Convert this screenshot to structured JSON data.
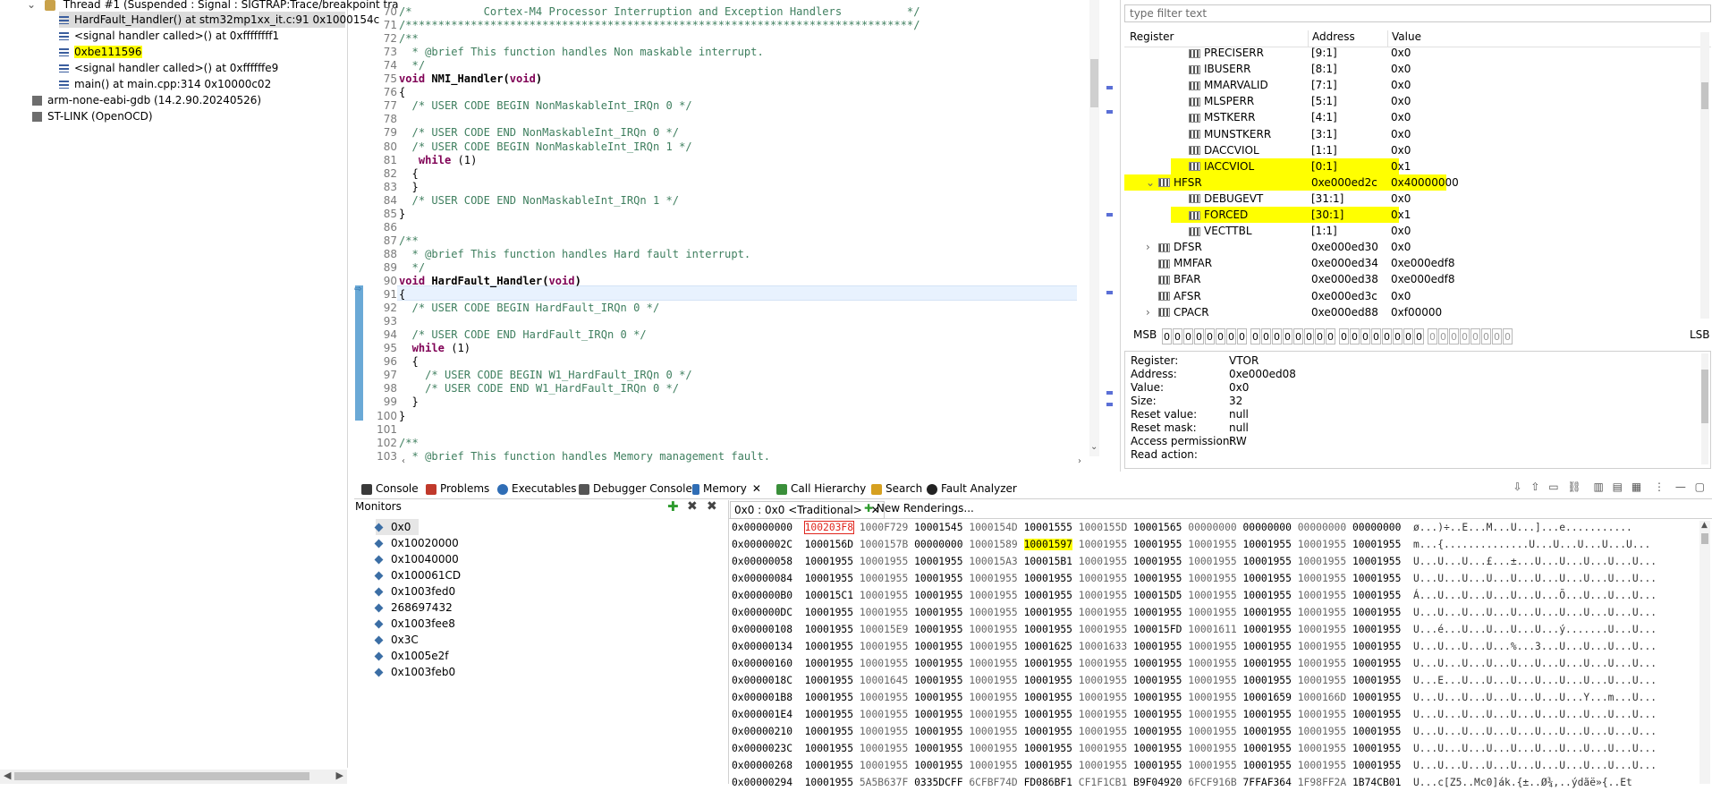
{
  "debug_tree": {
    "thread": "Thread #1 (Suspended : Signal : SIGTRAP:Trace/breakpoint tra",
    "frames": [
      "HardFault_Handler() at stm32mp1xx_it.c:91 0x1000154c",
      "<signal handler called>() at 0xffffffff1",
      "0xbe111596",
      "<signal handler called>() at 0xffffffe9",
      "main() at main.cpp:314 0x10000c02"
    ],
    "gdb": "arm-none-eabi-gdb (14.2.90.20240526)",
    "stlink": "ST-LINK (OpenOCD)"
  },
  "editor": {
    "lines": [
      {
        "n": "70",
        "t": "/*           Cortex-M4 Processor Interruption and Exception Handlers          */",
        "c": "cm"
      },
      {
        "n": "71",
        "t": "/******************************************************************************/",
        "c": "cm"
      },
      {
        "n": "72",
        "t": "/**",
        "c": "cm"
      },
      {
        "n": "73",
        "t": "  * @brief This function handles Non maskable interrupt.",
        "c": "cm"
      },
      {
        "n": "74",
        "t": "  */",
        "c": "cm"
      },
      {
        "n": "75",
        "t": "void NMI_Handler(void)",
        "c": "fnsig"
      },
      {
        "n": "76",
        "t": "{",
        "c": ""
      },
      {
        "n": "77",
        "t": "  /* USER CODE BEGIN NonMaskableInt_IRQn 0 */",
        "c": "cm"
      },
      {
        "n": "78",
        "t": "",
        "c": ""
      },
      {
        "n": "79",
        "t": "  /* USER CODE END NonMaskableInt_IRQn 0 */",
        "c": "cm"
      },
      {
        "n": "80",
        "t": "  /* USER CODE BEGIN NonMaskableInt_IRQn 1 */",
        "c": "cm"
      },
      {
        "n": "81",
        "t": "   while (1)",
        "c": "kw"
      },
      {
        "n": "82",
        "t": "  {",
        "c": ""
      },
      {
        "n": "83",
        "t": "  }",
        "c": ""
      },
      {
        "n": "84",
        "t": "  /* USER CODE END NonMaskableInt_IRQn 1 */",
        "c": "cm"
      },
      {
        "n": "85",
        "t": "}",
        "c": ""
      },
      {
        "n": "86",
        "t": "",
        "c": ""
      },
      {
        "n": "87",
        "t": "/**",
        "c": "cm"
      },
      {
        "n": "88",
        "t": "  * @brief This function handles Hard fault interrupt.",
        "c": "cm"
      },
      {
        "n": "89",
        "t": "  */",
        "c": "cm"
      },
      {
        "n": "90",
        "t": "void HardFault_Handler(void)",
        "c": "fnsig"
      },
      {
        "n": "91",
        "t": "{",
        "c": ""
      },
      {
        "n": "92",
        "t": "  /* USER CODE BEGIN HardFault_IRQn 0 */",
        "c": "cm"
      },
      {
        "n": "93",
        "t": "",
        "c": ""
      },
      {
        "n": "94",
        "t": "  /* USER CODE END HardFault_IRQn 0 */",
        "c": "cm"
      },
      {
        "n": "95",
        "t": "  while (1)",
        "c": "kw"
      },
      {
        "n": "96",
        "t": "  {",
        "c": ""
      },
      {
        "n": "97",
        "t": "    /* USER CODE BEGIN W1_HardFault_IRQn 0 */",
        "c": "cm"
      },
      {
        "n": "98",
        "t": "    /* USER CODE END W1_HardFault_IRQn 0 */",
        "c": "cm"
      },
      {
        "n": "99",
        "t": "  }",
        "c": ""
      },
      {
        "n": "100",
        "t": "}",
        "c": ""
      },
      {
        "n": "101",
        "t": "",
        "c": ""
      },
      {
        "n": "102",
        "t": "/**",
        "c": "cm"
      },
      {
        "n": "103",
        "t": "  * @brief This function handles Memory management fault.",
        "c": "cm"
      }
    ]
  },
  "registers": {
    "filter_placeholder": "type filter text",
    "headers": [
      "Register",
      "Address",
      "Value"
    ],
    "rows": [
      {
        "name": "PRECISERR",
        "addr": "[9:1]",
        "val": "0x0",
        "indent": 2,
        "hl": false,
        "exp": ""
      },
      {
        "name": "IBUSERR",
        "addr": "[8:1]",
        "val": "0x0",
        "indent": 2,
        "hl": false,
        "exp": ""
      },
      {
        "name": "MMARVALID",
        "addr": "[7:1]",
        "val": "0x0",
        "indent": 2,
        "hl": false,
        "exp": ""
      },
      {
        "name": "MLSPERR",
        "addr": "[5:1]",
        "val": "0x0",
        "indent": 2,
        "hl": false,
        "exp": ""
      },
      {
        "name": "MSTKERR",
        "addr": "[4:1]",
        "val": "0x0",
        "indent": 2,
        "hl": false,
        "exp": ""
      },
      {
        "name": "MUNSTKERR",
        "addr": "[3:1]",
        "val": "0x0",
        "indent": 2,
        "hl": false,
        "exp": ""
      },
      {
        "name": "DACCVIOL",
        "addr": "[1:1]",
        "val": "0x0",
        "indent": 2,
        "hl": false,
        "exp": ""
      },
      {
        "name": "IACCVIOL",
        "addr": "[0:1]",
        "val": "0x1",
        "indent": 2,
        "hl": true,
        "exp": ""
      },
      {
        "name": "HFSR",
        "addr": "0xe000ed2c",
        "val": "0x40000000",
        "indent": 1,
        "hl": true,
        "exp": "v"
      },
      {
        "name": "DEBUGEVT",
        "addr": "[31:1]",
        "val": "0x0",
        "indent": 2,
        "hl": false,
        "exp": ""
      },
      {
        "name": "FORCED",
        "addr": "[30:1]",
        "val": "0x1",
        "indent": 2,
        "hl": true,
        "exp": ""
      },
      {
        "name": "VECTTBL",
        "addr": "[1:1]",
        "val": "0x0",
        "indent": 2,
        "hl": false,
        "exp": ""
      },
      {
        "name": "DFSR",
        "addr": "0xe000ed30",
        "val": "0x0",
        "indent": 1,
        "hl": false,
        "exp": ">"
      },
      {
        "name": "MMFAR",
        "addr": "0xe000ed34",
        "val": "0xe000edf8",
        "indent": 1,
        "hl": false,
        "exp": ""
      },
      {
        "name": "BFAR",
        "addr": "0xe000ed38",
        "val": "0xe000edf8",
        "indent": 1,
        "hl": false,
        "exp": ""
      },
      {
        "name": "AFSR",
        "addr": "0xe000ed3c",
        "val": "0x0",
        "indent": 1,
        "hl": false,
        "exp": ""
      },
      {
        "name": "CPACR",
        "addr": "0xe000ed88",
        "val": "0xf00000",
        "indent": 1,
        "hl": false,
        "exp": ">"
      }
    ],
    "msb": "MSB",
    "lsb": "LSB",
    "details": [
      [
        "Register:",
        "VTOR"
      ],
      [
        "Address:",
        "0xe000ed08"
      ],
      [
        "Value:",
        "0x0"
      ],
      [
        "Size:",
        "32"
      ],
      [
        "Reset value:",
        "null"
      ],
      [
        "Reset mask:",
        "null"
      ],
      [
        "Access permission:",
        "RW"
      ],
      [
        "Read action:",
        ""
      ]
    ]
  },
  "bottom_tabs": [
    "Console",
    "Problems",
    "Executables",
    "Debugger Console",
    "Memory",
    "Call Hierarchy",
    "Search",
    "Fault Analyzer"
  ],
  "monitors": {
    "title": "Monitors",
    "items": [
      "0x0",
      "0x10020000",
      "0x10040000",
      "0x100061CD",
      "0x1003fed0",
      "268697432",
      "0x1003fee8",
      "0x3C",
      "0x1005e2f",
      "0x1003feb0"
    ]
  },
  "memory": {
    "rendering_tab": "0x0 : 0x0 <Traditional>",
    "new_renderings": "New Renderings...",
    "rows": [
      {
        "a": "0x00000000",
        "w": [
          "100203F8",
          "1000F729",
          "10001545",
          "1000154D",
          "10001555",
          "1000155D",
          "10001565",
          "00000000",
          "00000000",
          "00000000",
          "00000000"
        ],
        "t": "ø...)÷..E...M...U...]...e..........."
      },
      {
        "a": "0x0000002C",
        "w": [
          "1000156D",
          "1000157B",
          "00000000",
          "10001589",
          "10001597",
          "10001955",
          "10001955",
          "10001955",
          "10001955",
          "10001955",
          "10001955"
        ],
        "t": "m...{..............U...U...U...U...U..."
      },
      {
        "a": "0x00000058",
        "w": [
          "10001955",
          "10001955",
          "10001955",
          "100015A3",
          "100015B1",
          "10001955",
          "10001955",
          "10001955",
          "10001955",
          "10001955",
          "10001955"
        ],
        "t": "U...U...U...£...±...U...U...U...U...U..."
      },
      {
        "a": "0x00000084",
        "w": [
          "10001955",
          "10001955",
          "10001955",
          "10001955",
          "10001955",
          "10001955",
          "10001955",
          "10001955",
          "10001955",
          "10001955",
          "10001955"
        ],
        "t": "U...U...U...U...U...U...U...U...U...U..."
      },
      {
        "a": "0x000000B0",
        "w": [
          "100015C1",
          "10001955",
          "10001955",
          "10001955",
          "10001955",
          "10001955",
          "100015D5",
          "10001955",
          "10001955",
          "10001955",
          "10001955"
        ],
        "t": "Á...U...U...U...U...U...Õ...U...U...U..."
      },
      {
        "a": "0x000000DC",
        "w": [
          "10001955",
          "10001955",
          "10001955",
          "10001955",
          "10001955",
          "10001955",
          "10001955",
          "10001955",
          "10001955",
          "10001955",
          "10001955"
        ],
        "t": "U...U...U...U...U...U...U...U...U...U..."
      },
      {
        "a": "0x00000108",
        "w": [
          "10001955",
          "100015E9",
          "10001955",
          "10001955",
          "10001955",
          "10001955",
          "100015FD",
          "10001611",
          "10001955",
          "10001955",
          "10001955"
        ],
        "t": "U...é...U...U...U...U...ý.......U...U..."
      },
      {
        "a": "0x00000134",
        "w": [
          "10001955",
          "10001955",
          "10001955",
          "10001955",
          "10001625",
          "10001633",
          "10001955",
          "10001955",
          "10001955",
          "10001955",
          "10001955"
        ],
        "t": "U...U...U...U...%...3...U...U...U...U..."
      },
      {
        "a": "0x00000160",
        "w": [
          "10001955",
          "10001955",
          "10001955",
          "10001955",
          "10001955",
          "10001955",
          "10001955",
          "10001955",
          "10001955",
          "10001955",
          "10001955"
        ],
        "t": "U...U...U...U...U...U...U...U...U...U..."
      },
      {
        "a": "0x0000018C",
        "w": [
          "10001955",
          "10001645",
          "10001955",
          "10001955",
          "10001955",
          "10001955",
          "10001955",
          "10001955",
          "10001955",
          "10001955",
          "10001955"
        ],
        "t": "U...E...U...U...U...U...U...U...U...U..."
      },
      {
        "a": "0x000001B8",
        "w": [
          "10001955",
          "10001955",
          "10001955",
          "10001955",
          "10001955",
          "10001955",
          "10001955",
          "10001955",
          "10001659",
          "1000166D",
          "10001955"
        ],
        "t": "U...U...U...U...U...U...U...Y...m...U..."
      },
      {
        "a": "0x000001E4",
        "w": [
          "10001955",
          "10001955",
          "10001955",
          "10001955",
          "10001955",
          "10001955",
          "10001955",
          "10001955",
          "10001955",
          "10001955",
          "10001955"
        ],
        "t": "U...U...U...U...U...U...U...U...U...U..."
      },
      {
        "a": "0x00000210",
        "w": [
          "10001955",
          "10001955",
          "10001955",
          "10001955",
          "10001955",
          "10001955",
          "10001955",
          "10001955",
          "10001955",
          "10001955",
          "10001955"
        ],
        "t": "U...U...U...U...U...U...U...U...U...U..."
      },
      {
        "a": "0x0000023C",
        "w": [
          "10001955",
          "10001955",
          "10001955",
          "10001955",
          "10001955",
          "10001955",
          "10001955",
          "10001955",
          "10001955",
          "10001955",
          "10001955"
        ],
        "t": "U...U...U...U...U...U...U...U...U...U..."
      },
      {
        "a": "0x00000268",
        "w": [
          "10001955",
          "10001955",
          "10001955",
          "10001955",
          "10001955",
          "10001955",
          "10001955",
          "10001955",
          "10001955",
          "10001955",
          "10001955"
        ],
        "t": "U...U...U...U...U...U...U...U...U...U..."
      },
      {
        "a": "0x00000294",
        "w": [
          "10001955",
          "5A5B637F",
          "0335DCFF",
          "6CFBF74D",
          "FD086BF1",
          "CF1F1CB1",
          "B9F04920",
          "6FCF916B",
          "7FFAF364",
          "1F98FF2A",
          "1B74CB01"
        ],
        "t": "U...c[Z5..Mc0]ák.{±..Ø¾,..ýdãë»{..Et"
      }
    ]
  }
}
